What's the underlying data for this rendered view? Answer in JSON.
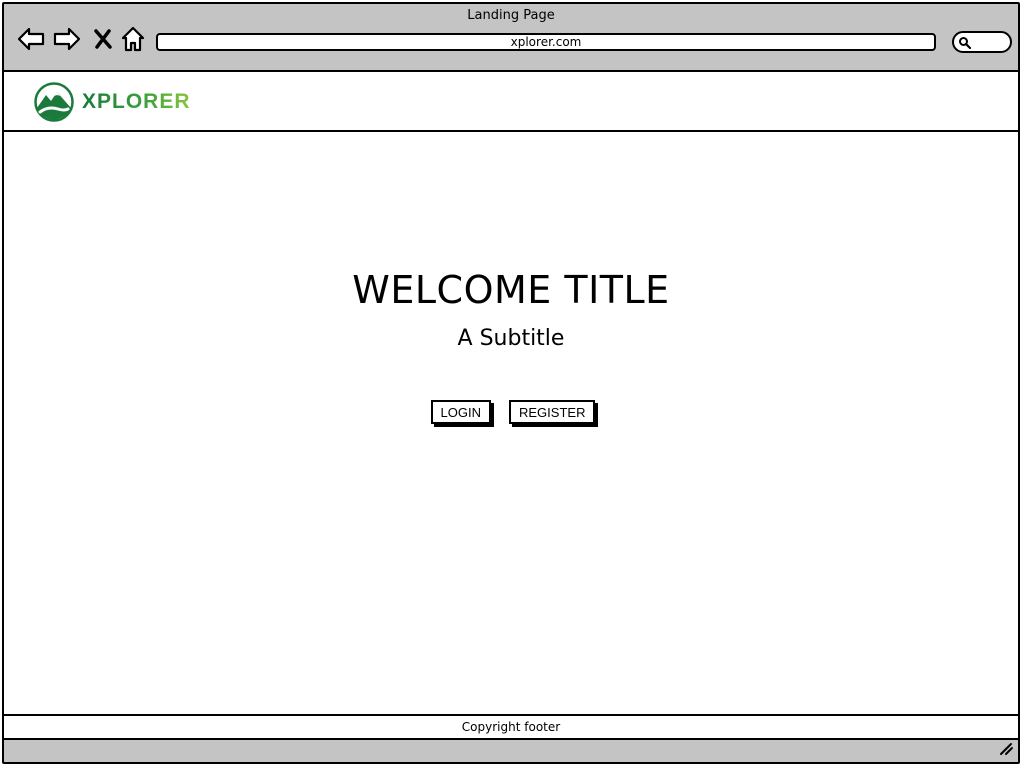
{
  "window": {
    "title": "Landing Page",
    "url": "xplorer.com"
  },
  "chrome": {
    "icons": [
      "back-arrow-icon",
      "forward-arrow-icon",
      "close-x-icon",
      "home-icon",
      "search-icon"
    ]
  },
  "header": {
    "logo_text": "XPLORER",
    "logo_colors": [
      "#1a7a3c",
      "#3ea33a",
      "#8cc63f"
    ]
  },
  "hero": {
    "title": "WELCOME TITLE",
    "subtitle": "A Subtitle"
  },
  "actions": {
    "login_label": "LOGIN",
    "register_label": "REGISTER"
  },
  "footer": {
    "text": "Copyright footer"
  }
}
